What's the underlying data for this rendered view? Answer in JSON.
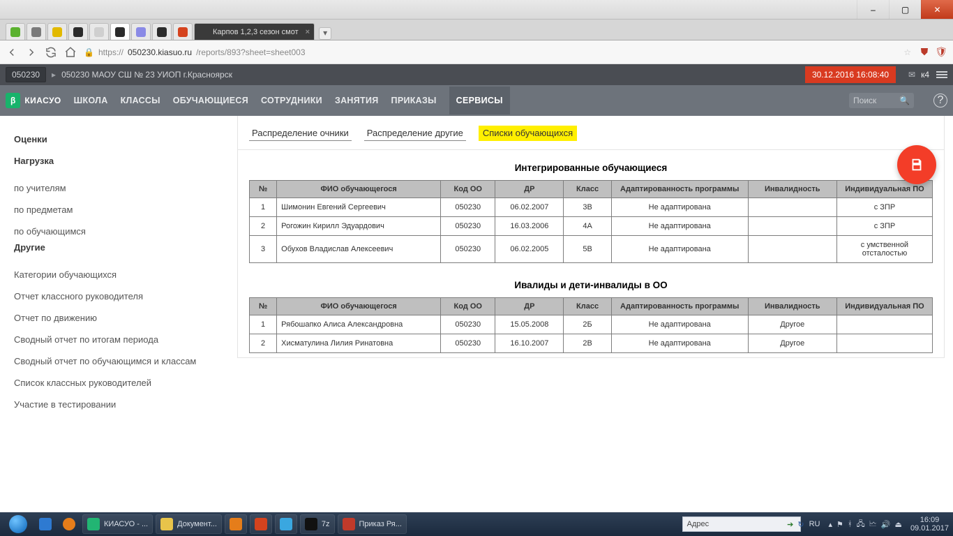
{
  "window": {
    "controls": {
      "min": "–",
      "max": "▢",
      "close": "✕"
    }
  },
  "browser_tabs": [
    {
      "favColor": "#5bb12f",
      "label": ""
    },
    {
      "favColor": "#7a7a7a",
      "label": ""
    },
    {
      "favColor": "#e2b900",
      "label": ""
    },
    {
      "favColor": "#2b2b2b",
      "label": ""
    },
    {
      "favColor": "#cfcfcf",
      "label": ""
    },
    {
      "favColor": "#2b2b2b",
      "label": "",
      "active": true
    },
    {
      "favColor": "#8a8ae6",
      "label": ""
    },
    {
      "favColor": "#2b2b2b",
      "label": ""
    },
    {
      "favColor": "#d5431e",
      "label": ""
    },
    {
      "favColor": "#3a3a3a",
      "label": "Карпов 1,2,3 сезон смот",
      "activeDark": true
    }
  ],
  "url": {
    "scheme": "https://",
    "host": "050230.kiasuo.ru",
    "path": "/reports/893?sheet=sheet003"
  },
  "crumb": {
    "code": "050230",
    "text": "050230 МАОУ СШ № 23 УИОП г.Красноярск",
    "timestamp": "30.12.2016 16:08:40",
    "user": "к4"
  },
  "brand": {
    "badge": "β",
    "name": "КИАСУО"
  },
  "mainnav": [
    "ШКОЛА",
    "КЛАССЫ",
    "ОБУЧАЮЩИЕСЯ",
    "СОТРУДНИКИ",
    "ЗАНЯТИЯ",
    "ПРИКАЗЫ",
    "СЕРВИСЫ"
  ],
  "mainnav_active": "СЕРВИСЫ",
  "search_placeholder": "Поиск",
  "sidebar": {
    "sections": [
      {
        "title": "Оценки",
        "items": []
      },
      {
        "title": "Нагрузка",
        "items": [
          "по учителям",
          "по предметам",
          "по обучающимся"
        ]
      },
      {
        "title": "Другие",
        "items": [
          "Категории обучающихся",
          "Отчет классного руководителя",
          "Отчет по движению",
          "Сводный отчет по итогам периода",
          "Сводный отчет по обучающимся и классам",
          "Список классных руководителей",
          "Участие в тестировании"
        ]
      }
    ]
  },
  "page_tabs": {
    "items": [
      "Распределение очники",
      "Распределение другие",
      "Списки обучающихся"
    ],
    "highlighted": 2
  },
  "tables": [
    {
      "title": "Интегрированные обучающиеся",
      "headers": [
        "№",
        "ФИО обучающегося",
        "Код ОО",
        "ДР",
        "Класс",
        "Адаптированность программы",
        "Инвалидность",
        "Индивидуальная ПО"
      ],
      "rows": [
        [
          "1",
          "Шимонин Евгений Сергеевич",
          "050230",
          "06.02.2007",
          "3В",
          "Не адаптирована",
          "",
          "с ЗПР"
        ],
        [
          "2",
          "Рогожин Кирилл Эдуардович",
          "050230",
          "16.03.2006",
          "4А",
          "Не адаптирована",
          "",
          "с ЗПР"
        ],
        [
          "3",
          "Обухов Владислав Алексеевич",
          "050230",
          "06.02.2005",
          "5В",
          "Не адаптирована",
          "",
          "с умственной отсталостью"
        ]
      ]
    },
    {
      "title": "Ивалиды и дети-инвалиды в ОО",
      "headers": [
        "№",
        "ФИО обучающегося",
        "Код ОО",
        "ДР",
        "Класс",
        "Адаптированность программы",
        "Инвалидность",
        "Индивидуальная ПО"
      ],
      "rows": [
        [
          "1",
          "Рябошапко Алиса Александровна",
          "050230",
          "15.05.2008",
          "2Б",
          "Не адаптирована",
          "Другое",
          ""
        ],
        [
          "2",
          "Хисматулина Лилия Ринатовна",
          "050230",
          "16.10.2007",
          "2В",
          "Не адаптирована",
          "Другое",
          ""
        ]
      ]
    }
  ],
  "taskbar": {
    "apps": [
      {
        "label": "КИАСУО - ...",
        "color": "#22b573"
      },
      {
        "label": "Документ...",
        "color": "#e8c44a"
      },
      {
        "label": "",
        "color": "#e57d1a"
      },
      {
        "label": "",
        "color": "#d5431e"
      },
      {
        "label": "",
        "color": "#3aa7e0"
      },
      {
        "label": "7z",
        "color": "#111"
      },
      {
        "label": "Приказ Ря...",
        "color": "#c13a2a"
      }
    ],
    "addr_label": "Адрес",
    "lang": "RU",
    "clock_time": "16:09",
    "clock_date": "09.01.2017"
  }
}
